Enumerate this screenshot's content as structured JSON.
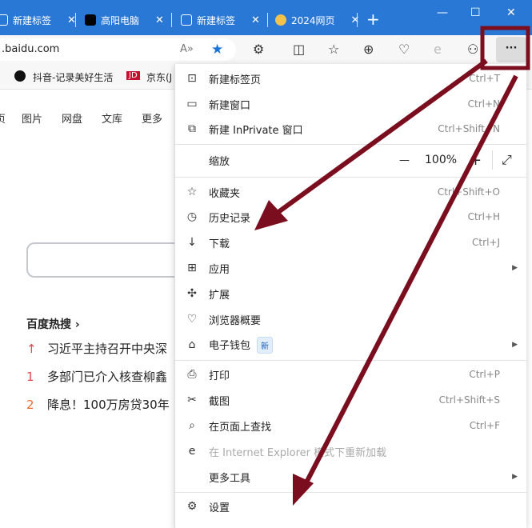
{
  "tabs": [
    {
      "label": "新建标签"
    },
    {
      "label": "高阳电脑"
    },
    {
      "label": "新建标签"
    },
    {
      "label": "2024网页"
    }
  ],
  "window_controls": {
    "minimize": "—",
    "maximize": "☐",
    "close": "✕"
  },
  "address": {
    "url": ".baidu.com"
  },
  "toolbar": {
    "more_label": "···"
  },
  "favorites": [
    "抖音-记录美好生活",
    "京东(J"
  ],
  "baidu": {
    "nav": [
      "页",
      "图片",
      "网盘",
      "文库",
      "更多"
    ],
    "hot_title": "百度热搜 ›",
    "hot_items": [
      {
        "rank": "↑",
        "text": "习近平主持召开中央深"
      },
      {
        "rank": "1",
        "text": "多部门已介入核查柳鑫"
      },
      {
        "rank": "2",
        "text": "降息！100万房贷30年"
      }
    ]
  },
  "menu": {
    "items1": [
      {
        "label": "新建标签页",
        "shortcut": "Ctrl+T",
        "icon": "new-tab-icon"
      },
      {
        "label": "新建窗口",
        "shortcut": "Ctrl+N",
        "icon": "new-window-icon"
      },
      {
        "label": "新建 InPrivate 窗口",
        "shortcut": "Ctrl+Shift+N",
        "icon": "inprivate-icon"
      }
    ],
    "zoom": {
      "label": "缩放",
      "value": "100%",
      "minus": "—",
      "plus": "+"
    },
    "items2": [
      {
        "label": "收藏夹",
        "shortcut": "Ctrl+Shift+O"
      },
      {
        "label": "历史记录",
        "shortcut": "Ctrl+H"
      },
      {
        "label": "下载",
        "shortcut": "Ctrl+J"
      },
      {
        "label": "应用",
        "shortcut": ""
      },
      {
        "label": "扩展",
        "shortcut": ""
      },
      {
        "label": "浏览器概要",
        "shortcut": ""
      },
      {
        "label": "电子钱包",
        "shortcut": "",
        "badge": "新"
      }
    ],
    "items3": [
      {
        "label": "打印",
        "shortcut": "Ctrl+P"
      },
      {
        "label": "截图",
        "shortcut": "Ctrl+Shift+S"
      },
      {
        "label": "在页面上查找",
        "shortcut": "Ctrl+F"
      },
      {
        "label": "在 Internet Explorer 模式下重新加载",
        "shortcut": ""
      },
      {
        "label": "更多工具",
        "shortcut": ""
      }
    ],
    "settings": {
      "label": "设置"
    }
  },
  "colors": {
    "titlebar": "#2a78d6",
    "annotation": "#7b0e1e"
  }
}
